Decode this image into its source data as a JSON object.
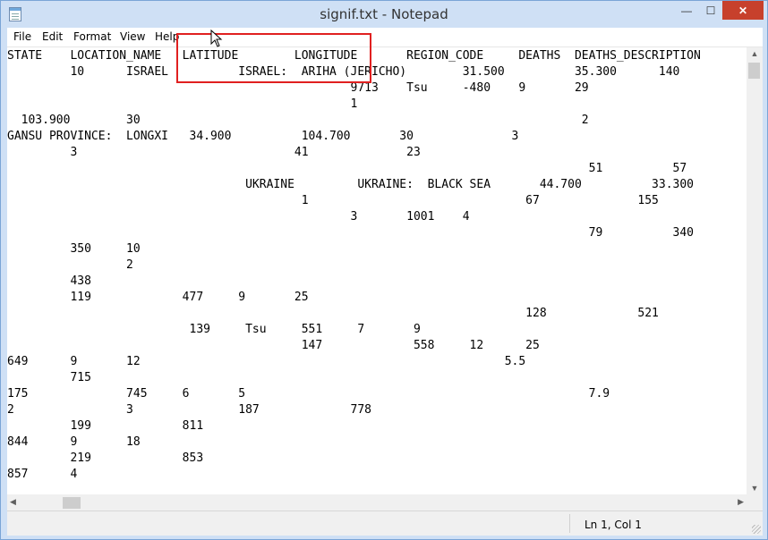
{
  "window": {
    "title": "signif.txt - Notepad"
  },
  "controls": {
    "minimize": "—",
    "maximize": "☐",
    "close": "✕"
  },
  "menu": [
    "File",
    "Edit",
    "Format",
    "View",
    "Help"
  ],
  "editor": {
    "lines": [
      "STATE    LOCATION_NAME   LATITUDE        LONGITUDE       REGION_CODE     DEATHS  DEATHS_DESCRIPTION",
      "         10      ISRAEL          ISRAEL:  ARIHA (JERICHO)        31.500          35.300      140",
      "                                                 9713    Tsu     -480    9       29",
      "                                                 1",
      "  103.900        30                                                               2",
      "GANSU PROVINCE:  LONGXI   34.900          104.700       30              3",
      "         3                               41              23",
      "                                                                                   51          57",
      "                                  UKRAINE         UKRAINE:  BLACK SEA       44.700          33.300",
      "                                          1                               67              155",
      "                                                 3       1001    4",
      "                                                                                   79          340",
      "         350     10",
      "                 2",
      "         438",
      "         119             477     9       25",
      "                                                                          128             521",
      "                          139     Tsu     551     7       9",
      "                                          147             558     12      25",
      "649      9       12                                                    5.5",
      "         715",
      "175              745     6       5                                                 7.9",
      "2                3               187             778",
      "         199             811",
      "844      9       18",
      "         219             853",
      "857      4"
    ],
    "line_offsets_px": []
  },
  "status": {
    "position": "Ln 1, Col 1"
  },
  "annotation": {
    "color": "#e02020"
  }
}
